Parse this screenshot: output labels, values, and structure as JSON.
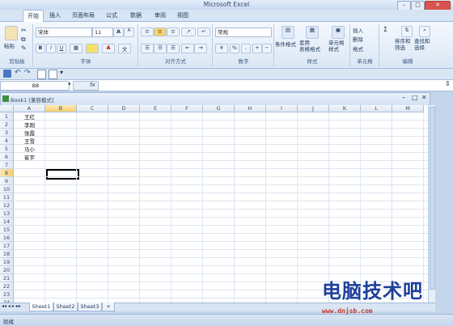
{
  "app_title": "Microsoft Excel",
  "ribbon_tabs": [
    "开始",
    "插入",
    "页面布局",
    "公式",
    "数据",
    "审阅",
    "视图"
  ],
  "clipboard": {
    "paste": "粘贴",
    "group": "剪贴板"
  },
  "font": {
    "name": "宋体",
    "size": "11",
    "group": "字体",
    "bold": "B",
    "italic": "I",
    "underline": "U",
    "grow": "A",
    "shrink": "A"
  },
  "alignment": {
    "group": "对齐方式"
  },
  "number": {
    "format": "常规",
    "percent": "%",
    "comma": ",",
    "group": "数字"
  },
  "styles": {
    "conditional": "条件格式",
    "table": "套用\n表格格式",
    "cell": "单元格\n样式",
    "group": "样式"
  },
  "cells": {
    "insert": "插入",
    "delete": "删除",
    "format": "格式",
    "group": "单元格"
  },
  "editing": {
    "sigma": "Σ",
    "sort": "排序和\n筛选",
    "find": "查找和\n选择",
    "group": "编辑"
  },
  "name_box": "B8",
  "fx": "fx",
  "workbook_title": "Book1 [兼容模式]",
  "columns": [
    "A",
    "B",
    "C",
    "D",
    "E",
    "F",
    "G",
    "H",
    "I",
    "J",
    "K",
    "L",
    "M"
  ],
  "rows": [
    "1",
    "2",
    "3",
    "4",
    "5",
    "6",
    "7",
    "8",
    "9",
    "10",
    "11",
    "12",
    "13",
    "14",
    "15",
    "16",
    "17",
    "18",
    "19",
    "20",
    "21",
    "22",
    "23",
    "24"
  ],
  "cell_values": [
    "王红",
    "李刚",
    "张霞",
    "王雪",
    "马小",
    "崔宇"
  ],
  "sheets": [
    "Sheet1",
    "Sheet2",
    "Sheet3"
  ],
  "status": "就绪",
  "watermark": {
    "title": "电脑技术吧",
    "url": "www.dnjsb.com"
  }
}
